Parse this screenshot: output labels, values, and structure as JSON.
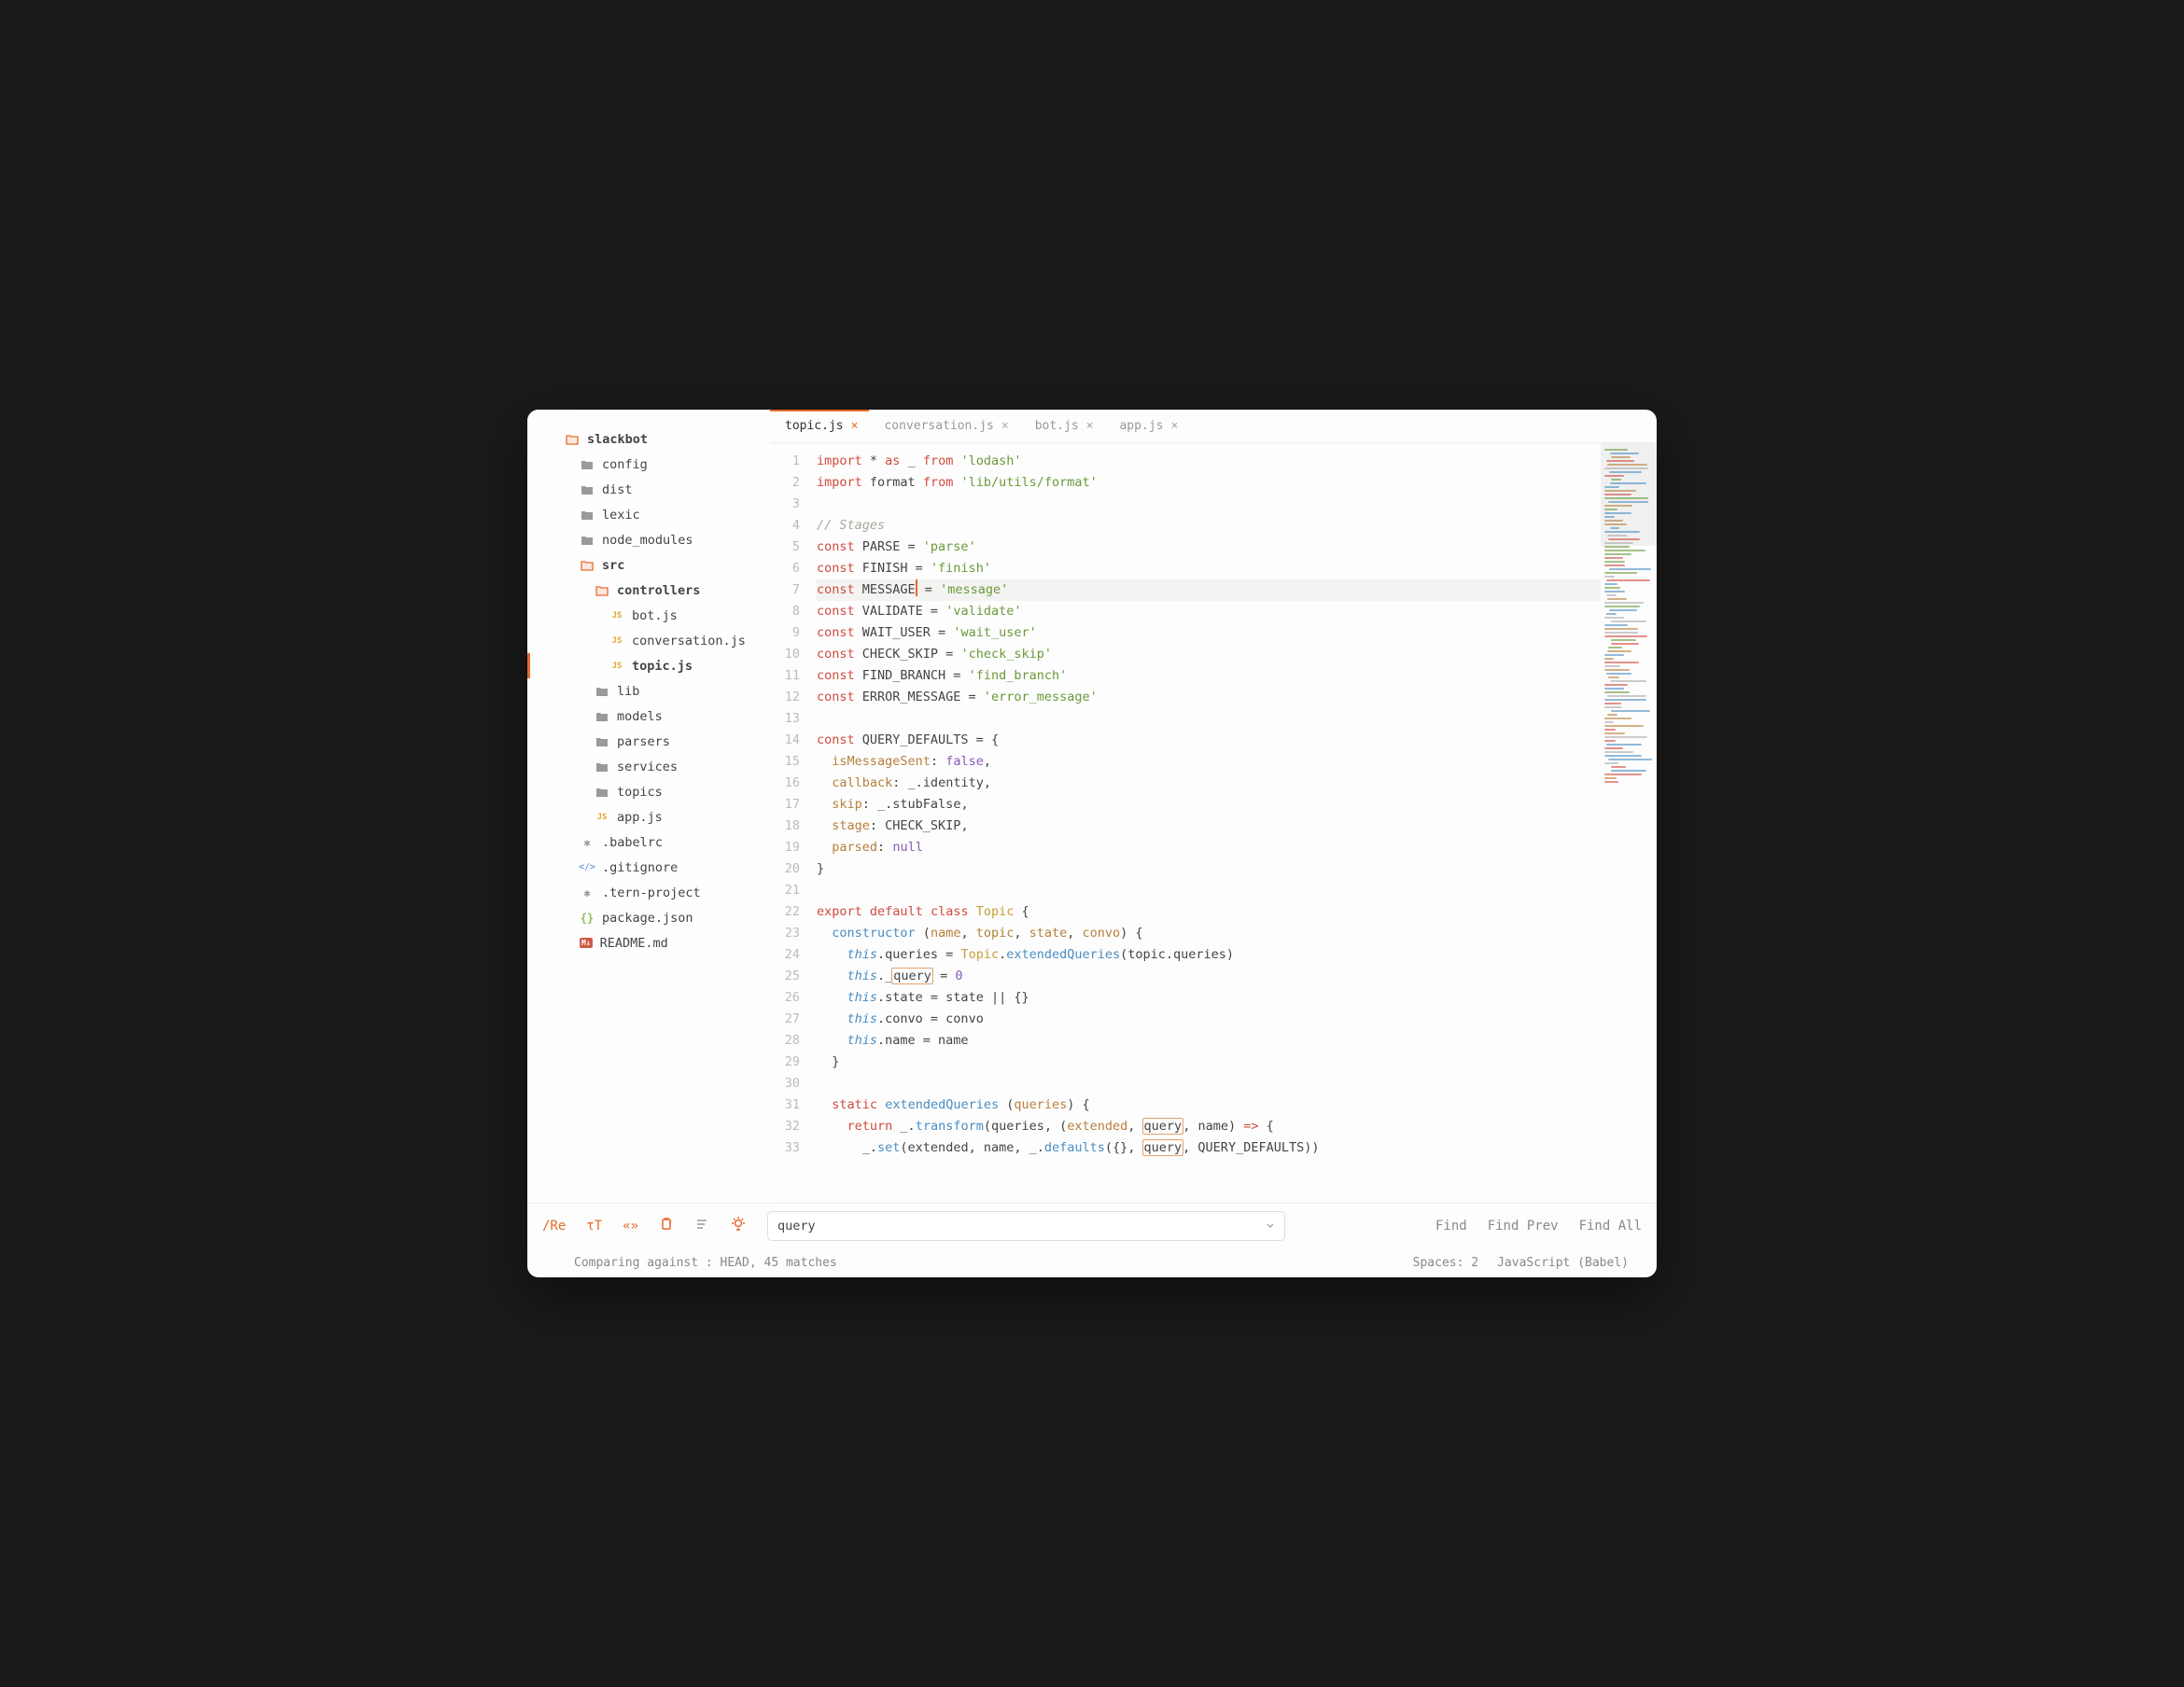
{
  "sidebar": {
    "root": "slackbot",
    "items": [
      {
        "depth": 0,
        "icon": "folder-open",
        "label": "slackbot",
        "bold": true
      },
      {
        "depth": 1,
        "icon": "folder-closed",
        "label": "config"
      },
      {
        "depth": 1,
        "icon": "folder-closed",
        "label": "dist"
      },
      {
        "depth": 1,
        "icon": "folder-closed",
        "label": "lexic"
      },
      {
        "depth": 1,
        "icon": "folder-closed",
        "label": "node_modules"
      },
      {
        "depth": 1,
        "icon": "folder-open",
        "label": "src",
        "bold": true
      },
      {
        "depth": 2,
        "icon": "folder-open",
        "label": "controllers",
        "bold": true
      },
      {
        "depth": 3,
        "icon": "js-file",
        "label": "bot.js"
      },
      {
        "depth": 3,
        "icon": "js-file",
        "label": "conversation.js"
      },
      {
        "depth": 3,
        "icon": "js-file",
        "label": "topic.js",
        "active": true,
        "bold": true
      },
      {
        "depth": 2,
        "icon": "folder-closed",
        "label": "lib"
      },
      {
        "depth": 2,
        "icon": "folder-closed",
        "label": "models"
      },
      {
        "depth": 2,
        "icon": "folder-closed",
        "label": "parsers"
      },
      {
        "depth": 2,
        "icon": "folder-closed",
        "label": "services"
      },
      {
        "depth": 2,
        "icon": "folder-closed",
        "label": "topics"
      },
      {
        "depth": 2,
        "icon": "js-file",
        "label": "app.js"
      },
      {
        "depth": 1,
        "icon": "asterisk",
        "label": ".babelrc"
      },
      {
        "depth": 1,
        "icon": "code-tag",
        "label": ".gitignore"
      },
      {
        "depth": 1,
        "icon": "asterisk",
        "label": ".tern-project"
      },
      {
        "depth": 1,
        "icon": "brackets",
        "label": "package.json"
      },
      {
        "depth": 1,
        "icon": "md-file",
        "label": "README.md"
      }
    ]
  },
  "tabs": [
    {
      "label": "topic.js",
      "active": true
    },
    {
      "label": "conversation.js",
      "active": false
    },
    {
      "label": "bot.js",
      "active": false
    },
    {
      "label": "app.js",
      "active": false
    }
  ],
  "code": {
    "highlighted_line": 7,
    "cursor_line": 7,
    "search_highlight": "query",
    "lines": [
      {
        "n": 1,
        "t": [
          [
            "kw",
            "import"
          ],
          [
            "plain",
            " * "
          ],
          [
            "kw",
            "as"
          ],
          [
            "plain",
            " _ "
          ],
          [
            "kw",
            "from"
          ],
          [
            "plain",
            " "
          ],
          [
            "str",
            "'lodash'"
          ]
        ]
      },
      {
        "n": 2,
        "t": [
          [
            "kw",
            "import"
          ],
          [
            "plain",
            " format "
          ],
          [
            "kw",
            "from"
          ],
          [
            "plain",
            " "
          ],
          [
            "str",
            "'lib/utils/format'"
          ]
        ]
      },
      {
        "n": 3,
        "t": []
      },
      {
        "n": 4,
        "t": [
          [
            "cmt",
            "// Stages"
          ]
        ]
      },
      {
        "n": 5,
        "t": [
          [
            "kw",
            "const"
          ],
          [
            "plain",
            " PARSE = "
          ],
          [
            "str",
            "'parse'"
          ]
        ]
      },
      {
        "n": 6,
        "t": [
          [
            "kw",
            "const"
          ],
          [
            "plain",
            " FINISH = "
          ],
          [
            "str",
            "'finish'"
          ]
        ]
      },
      {
        "n": 7,
        "t": [
          [
            "kw",
            "const"
          ],
          [
            "plain",
            " MESSAGE"
          ],
          [
            "cursor",
            ""
          ],
          [
            "plain",
            " = "
          ],
          [
            "str",
            "'message'"
          ]
        ]
      },
      {
        "n": 8,
        "t": [
          [
            "kw",
            "const"
          ],
          [
            "plain",
            " VALIDATE = "
          ],
          [
            "str",
            "'validate'"
          ]
        ]
      },
      {
        "n": 9,
        "t": [
          [
            "kw",
            "const"
          ],
          [
            "plain",
            " WAIT_USER = "
          ],
          [
            "str",
            "'wait_user'"
          ]
        ]
      },
      {
        "n": 10,
        "t": [
          [
            "kw",
            "const"
          ],
          [
            "plain",
            " CHECK_SKIP = "
          ],
          [
            "str",
            "'check_skip'"
          ]
        ]
      },
      {
        "n": 11,
        "t": [
          [
            "kw",
            "const"
          ],
          [
            "plain",
            " FIND_BRANCH = "
          ],
          [
            "str",
            "'find_branch'"
          ]
        ]
      },
      {
        "n": 12,
        "t": [
          [
            "kw",
            "const"
          ],
          [
            "plain",
            " ERROR_MESSAGE = "
          ],
          [
            "str",
            "'error_message'"
          ]
        ]
      },
      {
        "n": 13,
        "t": []
      },
      {
        "n": 14,
        "t": [
          [
            "kw",
            "const"
          ],
          [
            "plain",
            " QUERY_DEFAULTS = {"
          ]
        ]
      },
      {
        "n": 15,
        "t": [
          [
            "plain",
            "  "
          ],
          [
            "id",
            "isMessageSent"
          ],
          [
            "plain",
            ": "
          ],
          [
            "bool",
            "false"
          ],
          [
            "plain",
            ","
          ]
        ]
      },
      {
        "n": 16,
        "t": [
          [
            "plain",
            "  "
          ],
          [
            "id",
            "callback"
          ],
          [
            "plain",
            ": _.identity,"
          ]
        ]
      },
      {
        "n": 17,
        "t": [
          [
            "plain",
            "  "
          ],
          [
            "id",
            "skip"
          ],
          [
            "plain",
            ": _.stubFalse,"
          ]
        ]
      },
      {
        "n": 18,
        "t": [
          [
            "plain",
            "  "
          ],
          [
            "id",
            "stage"
          ],
          [
            "plain",
            ": CHECK_SKIP,"
          ]
        ]
      },
      {
        "n": 19,
        "t": [
          [
            "plain",
            "  "
          ],
          [
            "id",
            "parsed"
          ],
          [
            "plain",
            ": "
          ],
          [
            "bool",
            "null"
          ]
        ]
      },
      {
        "n": 20,
        "t": [
          [
            "plain",
            "}"
          ]
        ]
      },
      {
        "n": 21,
        "t": []
      },
      {
        "n": 22,
        "t": [
          [
            "kw",
            "export"
          ],
          [
            "plain",
            " "
          ],
          [
            "kw",
            "default"
          ],
          [
            "plain",
            " "
          ],
          [
            "kw",
            "class"
          ],
          [
            "plain",
            " "
          ],
          [
            "cls",
            "Topic"
          ],
          [
            "plain",
            " {"
          ]
        ]
      },
      {
        "n": 23,
        "t": [
          [
            "plain",
            "  "
          ],
          [
            "fn",
            "constructor"
          ],
          [
            "plain",
            " ("
          ],
          [
            "id",
            "name"
          ],
          [
            "plain",
            ", "
          ],
          [
            "id",
            "topic"
          ],
          [
            "plain",
            ", "
          ],
          [
            "id",
            "state"
          ],
          [
            "plain",
            ", "
          ],
          [
            "id",
            "convo"
          ],
          [
            "plain",
            ") {"
          ]
        ]
      },
      {
        "n": 24,
        "t": [
          [
            "plain",
            "    "
          ],
          [
            "this",
            "this"
          ],
          [
            "plain",
            ".queries = "
          ],
          [
            "cls",
            "Topic"
          ],
          [
            "plain",
            "."
          ],
          [
            "fn",
            "extendedQueries"
          ],
          [
            "plain",
            "(topic.queries)"
          ]
        ]
      },
      {
        "n": 25,
        "t": [
          [
            "plain",
            "    "
          ],
          [
            "this",
            "this"
          ],
          [
            "plain",
            "._"
          ],
          [
            "hl",
            "query"
          ],
          [
            "plain",
            " = "
          ],
          [
            "num",
            "0"
          ]
        ]
      },
      {
        "n": 26,
        "t": [
          [
            "plain",
            "    "
          ],
          [
            "this",
            "this"
          ],
          [
            "plain",
            ".state = state || {}"
          ]
        ]
      },
      {
        "n": 27,
        "t": [
          [
            "plain",
            "    "
          ],
          [
            "this",
            "this"
          ],
          [
            "plain",
            ".convo = convo"
          ]
        ]
      },
      {
        "n": 28,
        "t": [
          [
            "plain",
            "    "
          ],
          [
            "this",
            "this"
          ],
          [
            "plain",
            ".name = name"
          ]
        ]
      },
      {
        "n": 29,
        "t": [
          [
            "plain",
            "  }"
          ]
        ]
      },
      {
        "n": 30,
        "t": []
      },
      {
        "n": 31,
        "t": [
          [
            "plain",
            "  "
          ],
          [
            "kw",
            "static"
          ],
          [
            "plain",
            " "
          ],
          [
            "fn",
            "extendedQueries"
          ],
          [
            "plain",
            " ("
          ],
          [
            "id",
            "queries"
          ],
          [
            "plain",
            ") {"
          ]
        ]
      },
      {
        "n": 32,
        "t": [
          [
            "plain",
            "    "
          ],
          [
            "kw",
            "return"
          ],
          [
            "plain",
            " _."
          ],
          [
            "fn",
            "transform"
          ],
          [
            "plain",
            "(queries, ("
          ],
          [
            "id",
            "extended"
          ],
          [
            "plain",
            ", "
          ],
          [
            "hl",
            "query"
          ],
          [
            "plain",
            ", name) "
          ],
          [
            "kw",
            "=>"
          ],
          [
            "plain",
            " {"
          ]
        ]
      },
      {
        "n": 33,
        "t": [
          [
            "plain",
            "      _."
          ],
          [
            "fn",
            "set"
          ],
          [
            "plain",
            "(extended, name, _."
          ],
          [
            "fn",
            "defaults"
          ],
          [
            "plain",
            "({}, "
          ],
          [
            "hl",
            "query"
          ],
          [
            "plain",
            ", QUERY_DEFAULTS))"
          ]
        ]
      }
    ]
  },
  "search": {
    "value": "query",
    "actions": {
      "find": "Find",
      "prev": "Find Prev",
      "all": "Find All"
    },
    "icons": {
      "regex": "/Re",
      "case": "τT",
      "wrap": "«»",
      "clip": "clip",
      "lines": "lines",
      "bulb": "bulb"
    }
  },
  "status": {
    "left": "Comparing against : HEAD, 45 matches",
    "spaces": "Spaces: 2",
    "lang": "JavaScript (Babel)"
  }
}
